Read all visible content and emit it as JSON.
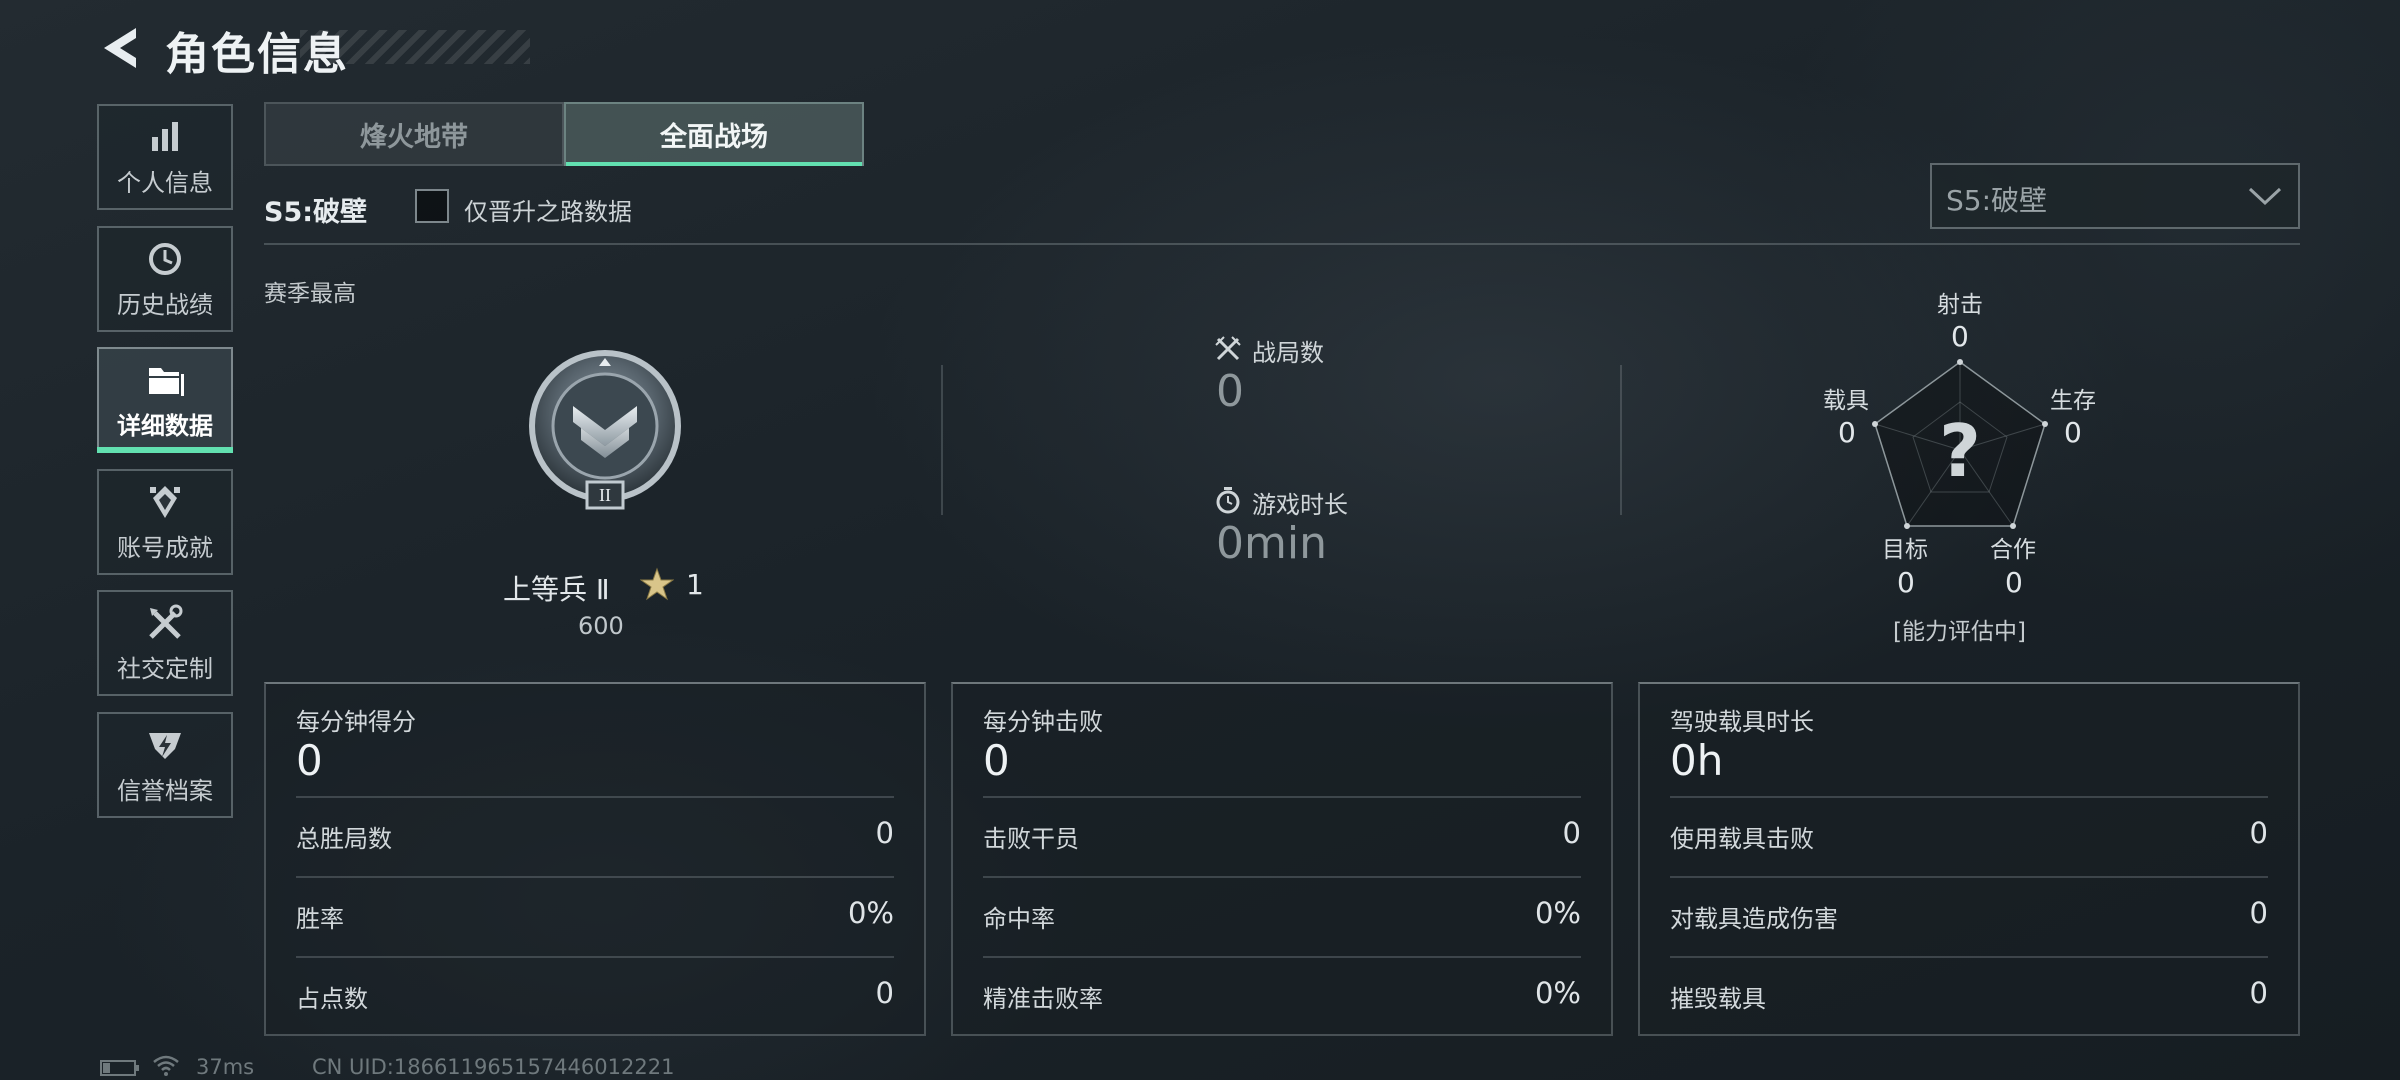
{
  "header": {
    "title": "角色信息"
  },
  "sidebar": {
    "items": [
      {
        "label": "个人信息",
        "icon": "bar-chart-icon",
        "active": false
      },
      {
        "label": "历史战绩",
        "icon": "clock-history-icon",
        "active": false
      },
      {
        "label": "详细数据",
        "icon": "folder-icon",
        "active": true
      },
      {
        "label": "账号成就",
        "icon": "achievement-badge-icon",
        "active": false
      },
      {
        "label": "社交定制",
        "icon": "tools-icon",
        "active": false
      },
      {
        "label": "信誉档案",
        "icon": "shield-emblem-icon",
        "active": false
      }
    ]
  },
  "tabs": [
    {
      "label": "烽火地带",
      "active": false
    },
    {
      "label": "全面战场",
      "active": true
    }
  ],
  "filter": {
    "season_label": "S5:破壁",
    "checkbox_label": "仅晋升之路数据",
    "checked": false,
    "season_select_value": "S5:破壁"
  },
  "season_best": {
    "label": "赛季最高",
    "rank_name": "上等兵 Ⅱ",
    "stars": "1",
    "points": "600",
    "badge_numeral": "II"
  },
  "overview": {
    "matches_label": "战局数",
    "matches_value": "0",
    "playtime_label": "游戏时长",
    "playtime_value": "0min"
  },
  "radar": {
    "labels": {
      "shooting": "射击",
      "survival": "生存",
      "teamwork": "合作",
      "objective": "目标",
      "vehicle": "载具"
    },
    "values": {
      "shooting": "0",
      "survival": "0",
      "teamwork": "0",
      "objective": "0",
      "vehicle": "0"
    },
    "center_mark": "?",
    "status": "[能力评估中]"
  },
  "cards": [
    {
      "title": "每分钟得分",
      "value": "0",
      "rows": [
        {
          "label": "总胜局数",
          "value": "0"
        },
        {
          "label": "胜率",
          "value": "0%"
        },
        {
          "label": "占点数",
          "value": "0"
        }
      ]
    },
    {
      "title": "每分钟击败",
      "value": "0",
      "rows": [
        {
          "label": "击败干员",
          "value": "0"
        },
        {
          "label": "命中率",
          "value": "0%"
        },
        {
          "label": "精准击败率",
          "value": "0%"
        }
      ]
    },
    {
      "title": "驾驶载具时长",
      "value": "0h",
      "rows": [
        {
          "label": "使用载具击败",
          "value": "0"
        },
        {
          "label": "对载具造成伤害",
          "value": "0"
        },
        {
          "label": "摧毁载具",
          "value": "0"
        }
      ]
    }
  ],
  "status_bar": {
    "ping": "37ms",
    "uid": "CN UID:18661196515744601222​1"
  },
  "colors": {
    "accent": "#62e0b0",
    "background": "#1b2329"
  }
}
